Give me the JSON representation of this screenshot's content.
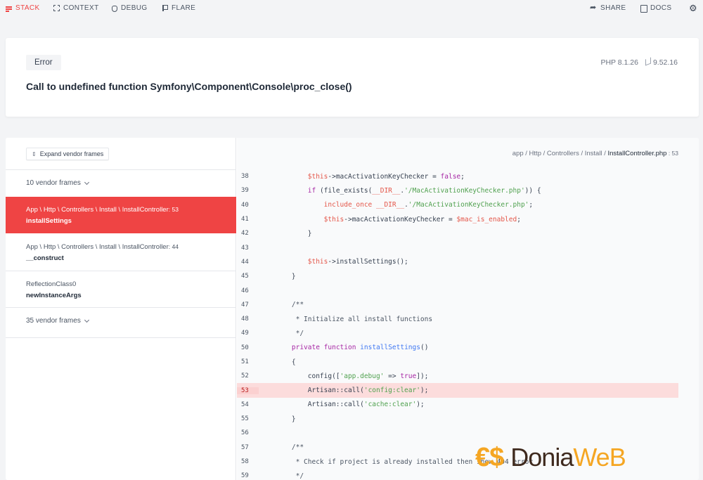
{
  "nav": {
    "left": [
      {
        "label": "STACK",
        "icon": "stack-icon",
        "active": true
      },
      {
        "label": "CONTEXT",
        "icon": "context-icon"
      },
      {
        "label": "DEBUG",
        "icon": "debug-icon"
      },
      {
        "label": "FLARE",
        "icon": "flare-icon"
      }
    ],
    "right": [
      {
        "label": "SHARE",
        "icon": "share-icon"
      },
      {
        "label": "DOCS",
        "icon": "docs-icon"
      }
    ],
    "settings_icon": "gear-icon"
  },
  "error": {
    "badge": "Error",
    "message": "Call to undefined function Symfony\\Component\\Console\\proc_close()",
    "php_version": "PHP 8.1.26",
    "laravel_version": "9.52.16"
  },
  "sidebar": {
    "expand_label": "Expand vendor frames",
    "vendor_top": "10 vendor frames",
    "vendor_bottom": "35 vendor frames",
    "frames": [
      {
        "path": "App \\ Http \\ Controllers \\ Install \\ InstallController",
        "line": ": 53",
        "fn": "installSettings",
        "active": true
      },
      {
        "path": "App \\ Http \\ Controllers \\ Install \\ InstallController",
        "line": ": 44",
        "fn": "__construct"
      },
      {
        "path": "ReflectionClass0",
        "line": "",
        "fn": "newInstanceArgs"
      }
    ]
  },
  "code": {
    "file_prefix": "app / Http / Controllers / Install / ",
    "file_name": "InstallController.php",
    "file_line": " : 53",
    "highlight_line": 53,
    "lines": [
      {
        "n": "38",
        "html": "        <span class=\"v\">$this</span>-&gt;macActivationKeyChecker = <span class=\"k\">false</span>;"
      },
      {
        "n": "39",
        "html": "        <span class=\"k\">if</span> (file_exists(<span class=\"v\">__DIR__</span>.<span class=\"s\">'/MacActivationKeyChecker.php'</span>)) {"
      },
      {
        "n": "40",
        "html": "            <span class=\"v\">include_once</span> <span class=\"v\">__DIR__</span>.<span class=\"s\">'/MacActivationKeyChecker.php'</span>;"
      },
      {
        "n": "41",
        "html": "            <span class=\"v\">$this</span>-&gt;macActivationKeyChecker = <span class=\"v\">$mac_is_enabled</span>;"
      },
      {
        "n": "42",
        "html": "        }"
      },
      {
        "n": "43",
        "html": ""
      },
      {
        "n": "44",
        "html": "        <span class=\"v\">$this</span>-&gt;installSettings();"
      },
      {
        "n": "45",
        "html": "    }"
      },
      {
        "n": "46",
        "html": ""
      },
      {
        "n": "47",
        "html": "    <span class=\"c\">/**</span>"
      },
      {
        "n": "48",
        "html": "<span class=\"c\">     * Initialize all install functions</span>"
      },
      {
        "n": "49",
        "html": "<span class=\"c\">     */</span>"
      },
      {
        "n": "50",
        "html": "    <span class=\"k\">private</span> <span class=\"k\">function</span> <span class=\"f\">installSettings</span>()"
      },
      {
        "n": "51",
        "html": "    {"
      },
      {
        "n": "52",
        "html": "        config([<span class=\"s\">'app.debug'</span> =&gt; <span class=\"k\">true</span>]);"
      },
      {
        "n": "53",
        "html": "        Artisan::call(<span class=\"s\">'config:clear'</span>);"
      },
      {
        "n": "54",
        "html": "        Artisan::call(<span class=\"s\">'cache:clear'</span>);"
      },
      {
        "n": "55",
        "html": "    }"
      },
      {
        "n": "56",
        "html": ""
      },
      {
        "n": "57",
        "html": "    <span class=\"c\">/**</span>"
      },
      {
        "n": "58",
        "html": "<span class=\"c\">     * Check if project is already installed then show 404 error</span>"
      },
      {
        "n": "59",
        "html": "<span class=\"c\">     */</span>"
      }
    ]
  },
  "watermark": {
    "coins": "€$",
    "text_a": "Donia",
    "text_b": "WeB"
  }
}
